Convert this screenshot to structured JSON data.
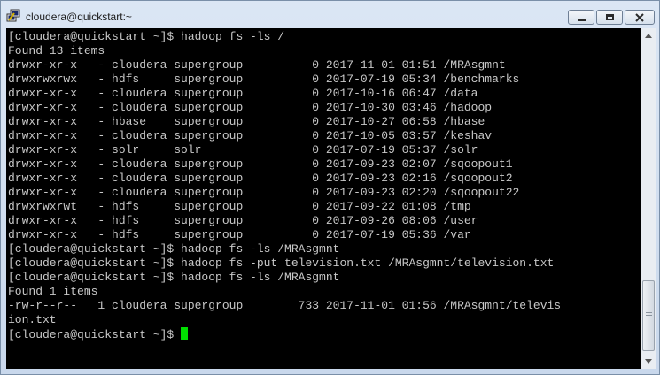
{
  "window": {
    "title": "cloudera@quickstart:~",
    "icon": "putty-terminal-icon"
  },
  "terminal": {
    "background": "#000000",
    "text_color": "#c8c8c8",
    "cursor_color": "#00e000",
    "lines": [
      "[cloudera@quickstart ~]$ hadoop fs -ls /",
      "Found 13 items",
      "drwxr-xr-x   - cloudera supergroup          0 2017-11-01 01:51 /MRAsgmnt",
      "drwxrwxrwx   - hdfs     supergroup          0 2017-07-19 05:34 /benchmarks",
      "drwxr-xr-x   - cloudera supergroup          0 2017-10-16 06:47 /data",
      "drwxr-xr-x   - cloudera supergroup          0 2017-10-30 03:46 /hadoop",
      "drwxr-xr-x   - hbase    supergroup          0 2017-10-27 06:58 /hbase",
      "drwxr-xr-x   - cloudera supergroup          0 2017-10-05 03:57 /keshav",
      "drwxr-xr-x   - solr     solr                0 2017-07-19 05:37 /solr",
      "drwxr-xr-x   - cloudera supergroup          0 2017-09-23 02:07 /sqoopout1",
      "drwxr-xr-x   - cloudera supergroup          0 2017-09-23 02:16 /sqoopout2",
      "drwxr-xr-x   - cloudera supergroup          0 2017-09-23 02:20 /sqoopout22",
      "drwxrwxrwt   - hdfs     supergroup          0 2017-09-22 01:08 /tmp",
      "drwxr-xr-x   - hdfs     supergroup          0 2017-09-26 08:06 /user",
      "drwxr-xr-x   - hdfs     supergroup          0 2017-07-19 05:36 /var",
      "[cloudera@quickstart ~]$ hadoop fs -ls /MRAsgmnt",
      "[cloudera@quickstart ~]$ hadoop fs -put television.txt /MRAsgmnt/television.txt",
      "[cloudera@quickstart ~]$ hadoop fs -ls /MRAsgmnt",
      "Found 1 items",
      "-rw-r--r--   1 cloudera supergroup        733 2017-11-01 01:56 /MRAsgmnt/televis",
      "ion.txt"
    ],
    "prompt": "[cloudera@quickstart ~]$ "
  }
}
